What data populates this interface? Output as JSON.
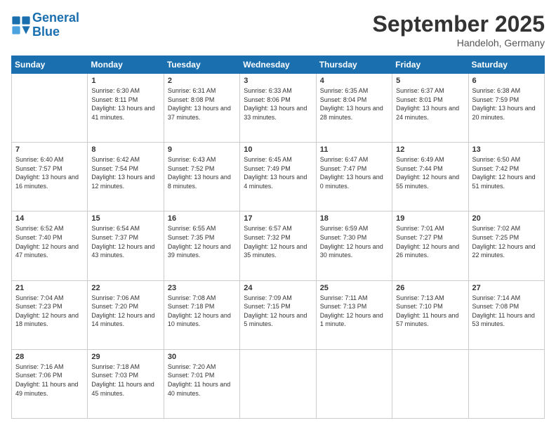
{
  "logo": {
    "line1": "General",
    "line2": "Blue"
  },
  "title": "September 2025",
  "location": "Handeloh, Germany",
  "days_of_week": [
    "Sunday",
    "Monday",
    "Tuesday",
    "Wednesday",
    "Thursday",
    "Friday",
    "Saturday"
  ],
  "weeks": [
    [
      {
        "day": "",
        "sunrise": "",
        "sunset": "",
        "daylight": ""
      },
      {
        "day": "1",
        "sunrise": "Sunrise: 6:30 AM",
        "sunset": "Sunset: 8:11 PM",
        "daylight": "Daylight: 13 hours and 41 minutes."
      },
      {
        "day": "2",
        "sunrise": "Sunrise: 6:31 AM",
        "sunset": "Sunset: 8:08 PM",
        "daylight": "Daylight: 13 hours and 37 minutes."
      },
      {
        "day": "3",
        "sunrise": "Sunrise: 6:33 AM",
        "sunset": "Sunset: 8:06 PM",
        "daylight": "Daylight: 13 hours and 33 minutes."
      },
      {
        "day": "4",
        "sunrise": "Sunrise: 6:35 AM",
        "sunset": "Sunset: 8:04 PM",
        "daylight": "Daylight: 13 hours and 28 minutes."
      },
      {
        "day": "5",
        "sunrise": "Sunrise: 6:37 AM",
        "sunset": "Sunset: 8:01 PM",
        "daylight": "Daylight: 13 hours and 24 minutes."
      },
      {
        "day": "6",
        "sunrise": "Sunrise: 6:38 AM",
        "sunset": "Sunset: 7:59 PM",
        "daylight": "Daylight: 13 hours and 20 minutes."
      }
    ],
    [
      {
        "day": "7",
        "sunrise": "Sunrise: 6:40 AM",
        "sunset": "Sunset: 7:57 PM",
        "daylight": "Daylight: 13 hours and 16 minutes."
      },
      {
        "day": "8",
        "sunrise": "Sunrise: 6:42 AM",
        "sunset": "Sunset: 7:54 PM",
        "daylight": "Daylight: 13 hours and 12 minutes."
      },
      {
        "day": "9",
        "sunrise": "Sunrise: 6:43 AM",
        "sunset": "Sunset: 7:52 PM",
        "daylight": "Daylight: 13 hours and 8 minutes."
      },
      {
        "day": "10",
        "sunrise": "Sunrise: 6:45 AM",
        "sunset": "Sunset: 7:49 PM",
        "daylight": "Daylight: 13 hours and 4 minutes."
      },
      {
        "day": "11",
        "sunrise": "Sunrise: 6:47 AM",
        "sunset": "Sunset: 7:47 PM",
        "daylight": "Daylight: 13 hours and 0 minutes."
      },
      {
        "day": "12",
        "sunrise": "Sunrise: 6:49 AM",
        "sunset": "Sunset: 7:44 PM",
        "daylight": "Daylight: 12 hours and 55 minutes."
      },
      {
        "day": "13",
        "sunrise": "Sunrise: 6:50 AM",
        "sunset": "Sunset: 7:42 PM",
        "daylight": "Daylight: 12 hours and 51 minutes."
      }
    ],
    [
      {
        "day": "14",
        "sunrise": "Sunrise: 6:52 AM",
        "sunset": "Sunset: 7:40 PM",
        "daylight": "Daylight: 12 hours and 47 minutes."
      },
      {
        "day": "15",
        "sunrise": "Sunrise: 6:54 AM",
        "sunset": "Sunset: 7:37 PM",
        "daylight": "Daylight: 12 hours and 43 minutes."
      },
      {
        "day": "16",
        "sunrise": "Sunrise: 6:55 AM",
        "sunset": "Sunset: 7:35 PM",
        "daylight": "Daylight: 12 hours and 39 minutes."
      },
      {
        "day": "17",
        "sunrise": "Sunrise: 6:57 AM",
        "sunset": "Sunset: 7:32 PM",
        "daylight": "Daylight: 12 hours and 35 minutes."
      },
      {
        "day": "18",
        "sunrise": "Sunrise: 6:59 AM",
        "sunset": "Sunset: 7:30 PM",
        "daylight": "Daylight: 12 hours and 30 minutes."
      },
      {
        "day": "19",
        "sunrise": "Sunrise: 7:01 AM",
        "sunset": "Sunset: 7:27 PM",
        "daylight": "Daylight: 12 hours and 26 minutes."
      },
      {
        "day": "20",
        "sunrise": "Sunrise: 7:02 AM",
        "sunset": "Sunset: 7:25 PM",
        "daylight": "Daylight: 12 hours and 22 minutes."
      }
    ],
    [
      {
        "day": "21",
        "sunrise": "Sunrise: 7:04 AM",
        "sunset": "Sunset: 7:23 PM",
        "daylight": "Daylight: 12 hours and 18 minutes."
      },
      {
        "day": "22",
        "sunrise": "Sunrise: 7:06 AM",
        "sunset": "Sunset: 7:20 PM",
        "daylight": "Daylight: 12 hours and 14 minutes."
      },
      {
        "day": "23",
        "sunrise": "Sunrise: 7:08 AM",
        "sunset": "Sunset: 7:18 PM",
        "daylight": "Daylight: 12 hours and 10 minutes."
      },
      {
        "day": "24",
        "sunrise": "Sunrise: 7:09 AM",
        "sunset": "Sunset: 7:15 PM",
        "daylight": "Daylight: 12 hours and 5 minutes."
      },
      {
        "day": "25",
        "sunrise": "Sunrise: 7:11 AM",
        "sunset": "Sunset: 7:13 PM",
        "daylight": "Daylight: 12 hours and 1 minute."
      },
      {
        "day": "26",
        "sunrise": "Sunrise: 7:13 AM",
        "sunset": "Sunset: 7:10 PM",
        "daylight": "Daylight: 11 hours and 57 minutes."
      },
      {
        "day": "27",
        "sunrise": "Sunrise: 7:14 AM",
        "sunset": "Sunset: 7:08 PM",
        "daylight": "Daylight: 11 hours and 53 minutes."
      }
    ],
    [
      {
        "day": "28",
        "sunrise": "Sunrise: 7:16 AM",
        "sunset": "Sunset: 7:06 PM",
        "daylight": "Daylight: 11 hours and 49 minutes."
      },
      {
        "day": "29",
        "sunrise": "Sunrise: 7:18 AM",
        "sunset": "Sunset: 7:03 PM",
        "daylight": "Daylight: 11 hours and 45 minutes."
      },
      {
        "day": "30",
        "sunrise": "Sunrise: 7:20 AM",
        "sunset": "Sunset: 7:01 PM",
        "daylight": "Daylight: 11 hours and 40 minutes."
      },
      {
        "day": "",
        "sunrise": "",
        "sunset": "",
        "daylight": ""
      },
      {
        "day": "",
        "sunrise": "",
        "sunset": "",
        "daylight": ""
      },
      {
        "day": "",
        "sunrise": "",
        "sunset": "",
        "daylight": ""
      },
      {
        "day": "",
        "sunrise": "",
        "sunset": "",
        "daylight": ""
      }
    ]
  ]
}
